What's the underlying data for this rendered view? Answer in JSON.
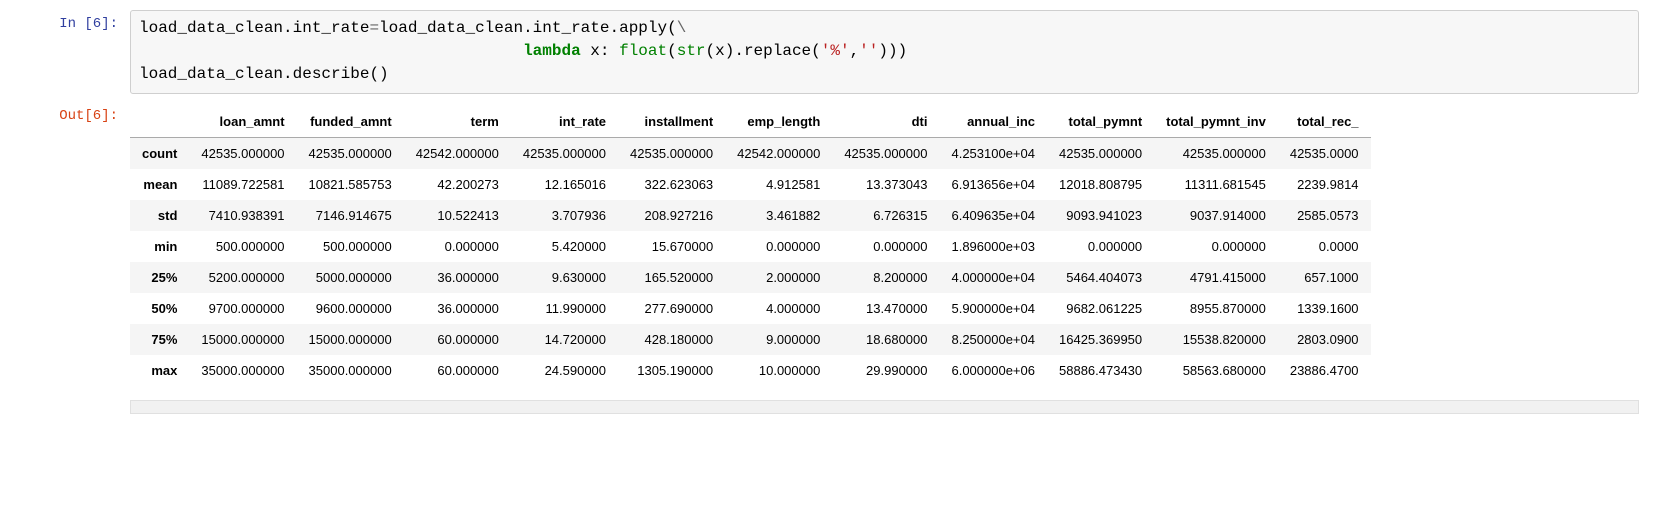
{
  "input": {
    "prompt": "In  [6]:",
    "code_lines": [
      "load_data_clean.int_rate=load_data_clean.int_rate.apply(\\",
      "                                        lambda x: float(str(x).replace('%','')))",
      "load_data_clean.describe()"
    ]
  },
  "output": {
    "prompt": "Out[6]:",
    "table": {
      "columns": [
        "loan_amnt",
        "funded_amnt",
        "term",
        "int_rate",
        "installment",
        "emp_length",
        "dti",
        "annual_inc",
        "total_pymnt",
        "total_pymnt_inv",
        "total_rec_"
      ],
      "index": [
        "count",
        "mean",
        "std",
        "min",
        "25%",
        "50%",
        "75%",
        "max"
      ],
      "rows": [
        [
          "42535.000000",
          "42535.000000",
          "42542.000000",
          "42535.000000",
          "42535.000000",
          "42542.000000",
          "42535.000000",
          "4.253100e+04",
          "42535.000000",
          "42535.000000",
          "42535.0000"
        ],
        [
          "11089.722581",
          "10821.585753",
          "42.200273",
          "12.165016",
          "322.623063",
          "4.912581",
          "13.373043",
          "6.913656e+04",
          "12018.808795",
          "11311.681545",
          "2239.9814"
        ],
        [
          "7410.938391",
          "7146.914675",
          "10.522413",
          "3.707936",
          "208.927216",
          "3.461882",
          "6.726315",
          "6.409635e+04",
          "9093.941023",
          "9037.914000",
          "2585.0573"
        ],
        [
          "500.000000",
          "500.000000",
          "0.000000",
          "5.420000",
          "15.670000",
          "0.000000",
          "0.000000",
          "1.896000e+03",
          "0.000000",
          "0.000000",
          "0.0000"
        ],
        [
          "5200.000000",
          "5000.000000",
          "36.000000",
          "9.630000",
          "165.520000",
          "2.000000",
          "8.200000",
          "4.000000e+04",
          "5464.404073",
          "4791.415000",
          "657.1000"
        ],
        [
          "9700.000000",
          "9600.000000",
          "36.000000",
          "11.990000",
          "277.690000",
          "4.000000",
          "13.470000",
          "5.900000e+04",
          "9682.061225",
          "8955.870000",
          "1339.1600"
        ],
        [
          "15000.000000",
          "15000.000000",
          "60.000000",
          "14.720000",
          "428.180000",
          "9.000000",
          "18.680000",
          "8.250000e+04",
          "16425.369950",
          "15538.820000",
          "2803.0900"
        ],
        [
          "35000.000000",
          "35000.000000",
          "60.000000",
          "24.590000",
          "1305.190000",
          "10.000000",
          "29.990000",
          "6.000000e+06",
          "58886.473430",
          "58563.680000",
          "23886.4700"
        ]
      ]
    }
  }
}
